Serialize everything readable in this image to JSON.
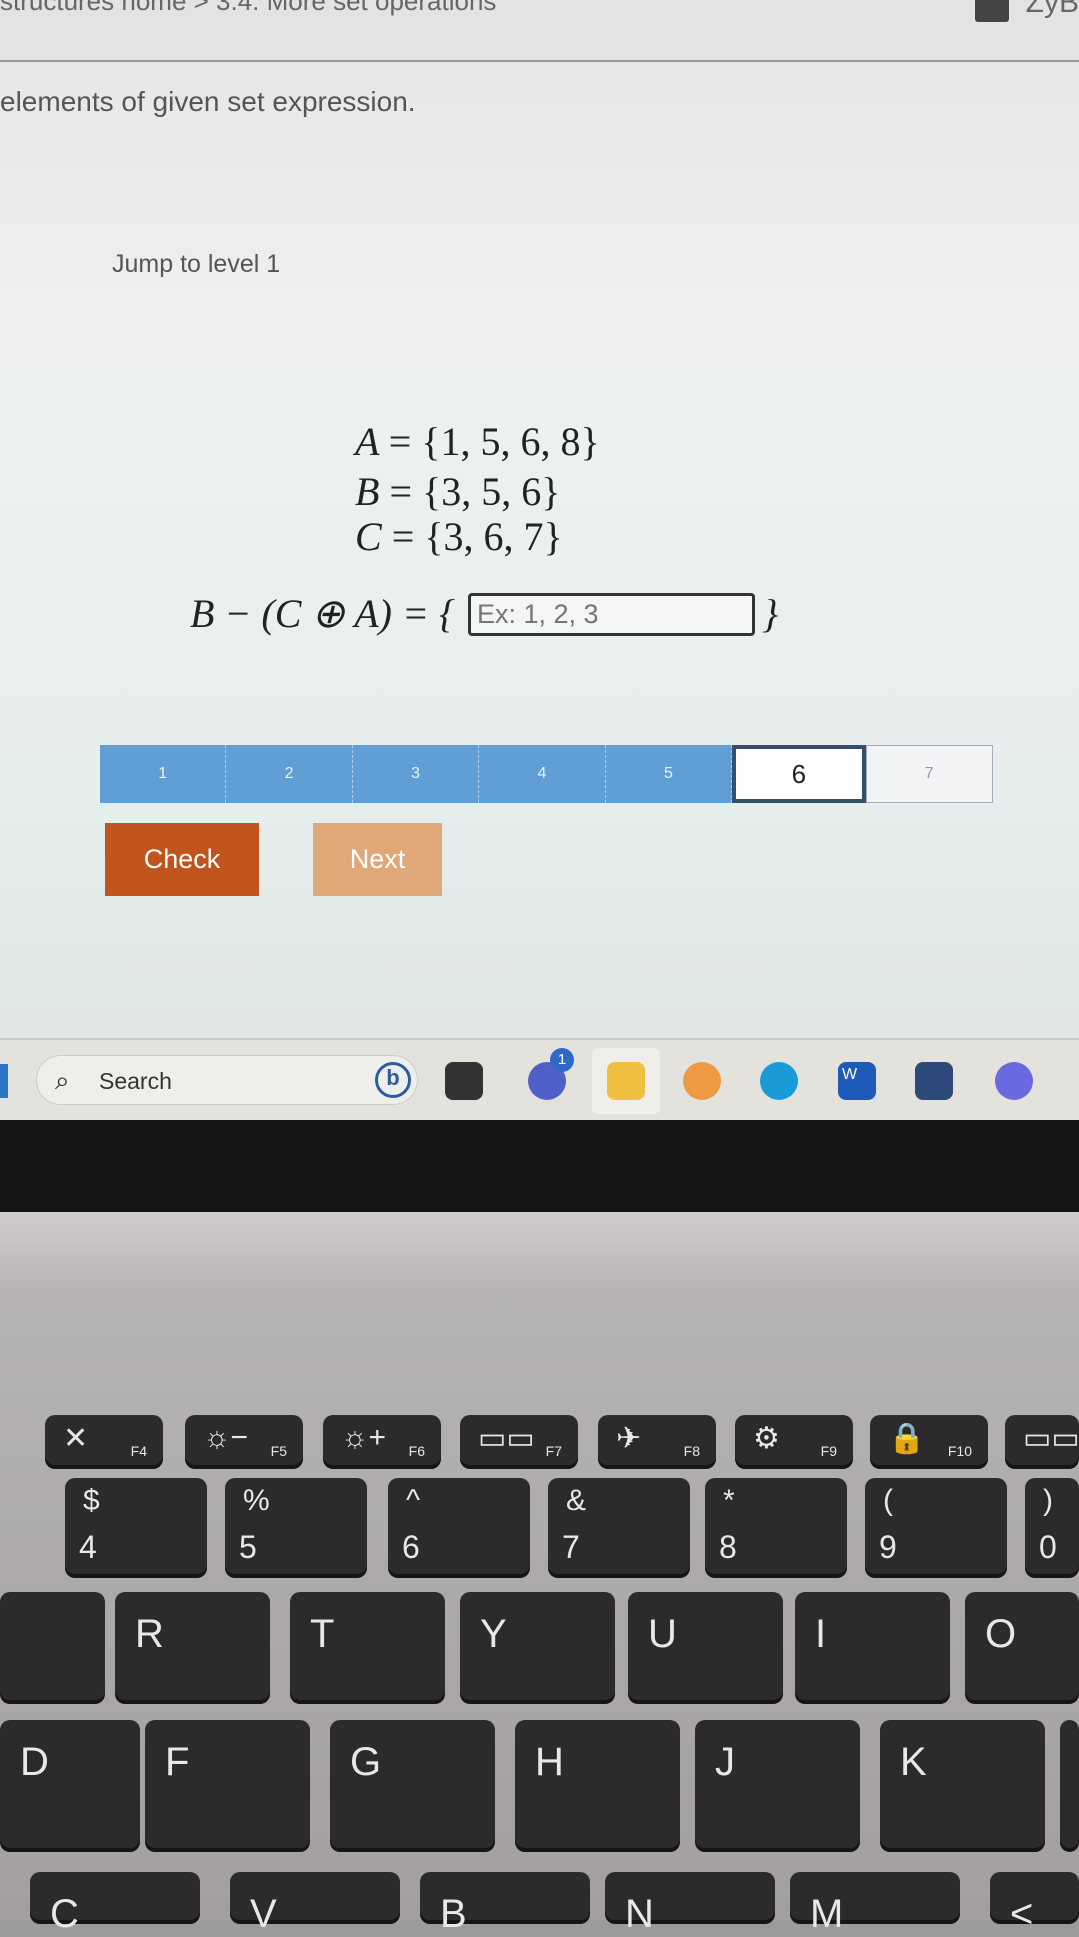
{
  "header": {
    "breadcrumb": "structures home > 3.4. More set operations",
    "brand": "ZyB"
  },
  "instruction": "elements of given set expression.",
  "jump_label": "Jump to level 1",
  "sets": [
    {
      "name": "A",
      "value": "= {1, 5, 6, 8}"
    },
    {
      "name": "B",
      "value": "= {3, 5, 6}"
    },
    {
      "name": "C",
      "value": "= {3, 6, 7}"
    }
  ],
  "expression": "B − (C ⊕ A) = {",
  "expression_close": "}",
  "answer": {
    "value": "",
    "placeholder": "Ex: 1, 2, 3"
  },
  "levels": {
    "labels": [
      "1",
      "2",
      "3",
      "4",
      "5",
      "6",
      "7"
    ],
    "completed": 5,
    "current": "6",
    "color_done": "#5f9fd6"
  },
  "buttons": {
    "check": "Check",
    "next": "Next",
    "check_color": "#c0541c",
    "next_color": "#e0a779"
  },
  "taskbar": {
    "search_placeholder": "Search",
    "teams_badge": "1",
    "word_letter": "W"
  },
  "keyboard": {
    "fn": [
      [
        "✕",
        "F4"
      ],
      [
        "☼−",
        "F5"
      ],
      [
        "☼+",
        "F6"
      ],
      [
        "▭▭",
        "F7"
      ],
      [
        "✈",
        "F8"
      ],
      [
        "⚙",
        "F9"
      ],
      [
        "🔒",
        "F10"
      ],
      [
        "▭▭▭",
        ""
      ]
    ],
    "num": [
      [
        "$",
        "4"
      ],
      [
        "%",
        "5"
      ],
      [
        "^",
        "6"
      ],
      [
        "&",
        "7"
      ],
      [
        "*",
        "8"
      ],
      [
        "(",
        "9"
      ],
      [
        ")",
        "0"
      ]
    ],
    "top": [
      "",
      "R",
      "T",
      "Y",
      "U",
      "I",
      "O"
    ],
    "mid": [
      "D",
      "F",
      "G",
      "H",
      "J",
      "K",
      ""
    ],
    "bot": [
      "C",
      "V",
      "B",
      "N",
      "M",
      "<"
    ]
  }
}
